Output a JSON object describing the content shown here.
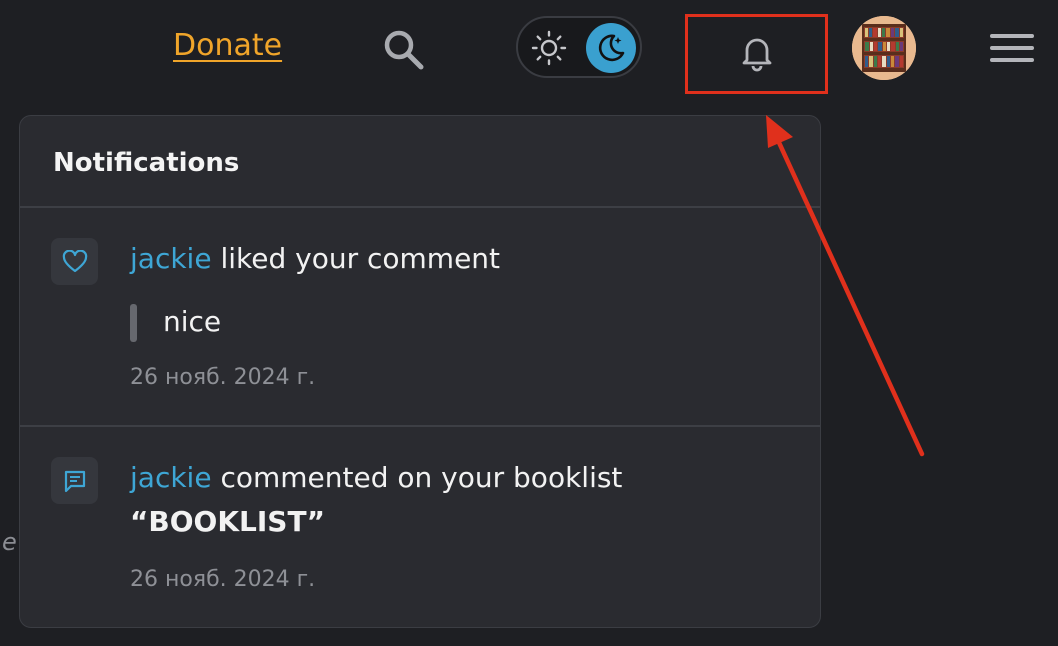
{
  "header": {
    "donate_label": "Donate",
    "search_icon": "search-icon",
    "theme_toggle": {
      "light_icon": "sun-icon",
      "dark_icon": "moon-icon",
      "active": "dark"
    },
    "notifications_icon": "bell-icon",
    "avatar_icon": "bookshelf-avatar",
    "menu_icon": "hamburger-menu-icon"
  },
  "background_text": "e",
  "notifications": {
    "title": "Notifications",
    "items": [
      {
        "icon": "heart-icon",
        "user": "jackie",
        "action": "liked your comment",
        "quote": "nice",
        "date": "26 нояб. 2024 г."
      },
      {
        "icon": "comment-icon",
        "user": "jackie",
        "action": "commented on your booklist",
        "target": "“BOOKLIST”",
        "date": "26 нояб. 2024 г."
      }
    ]
  },
  "colors": {
    "background": "#1e1f23",
    "panel": "#2a2b30",
    "accent_blue": "#3ea6d5",
    "donate_orange": "#f0a52a",
    "highlight_red": "#e0301c"
  }
}
